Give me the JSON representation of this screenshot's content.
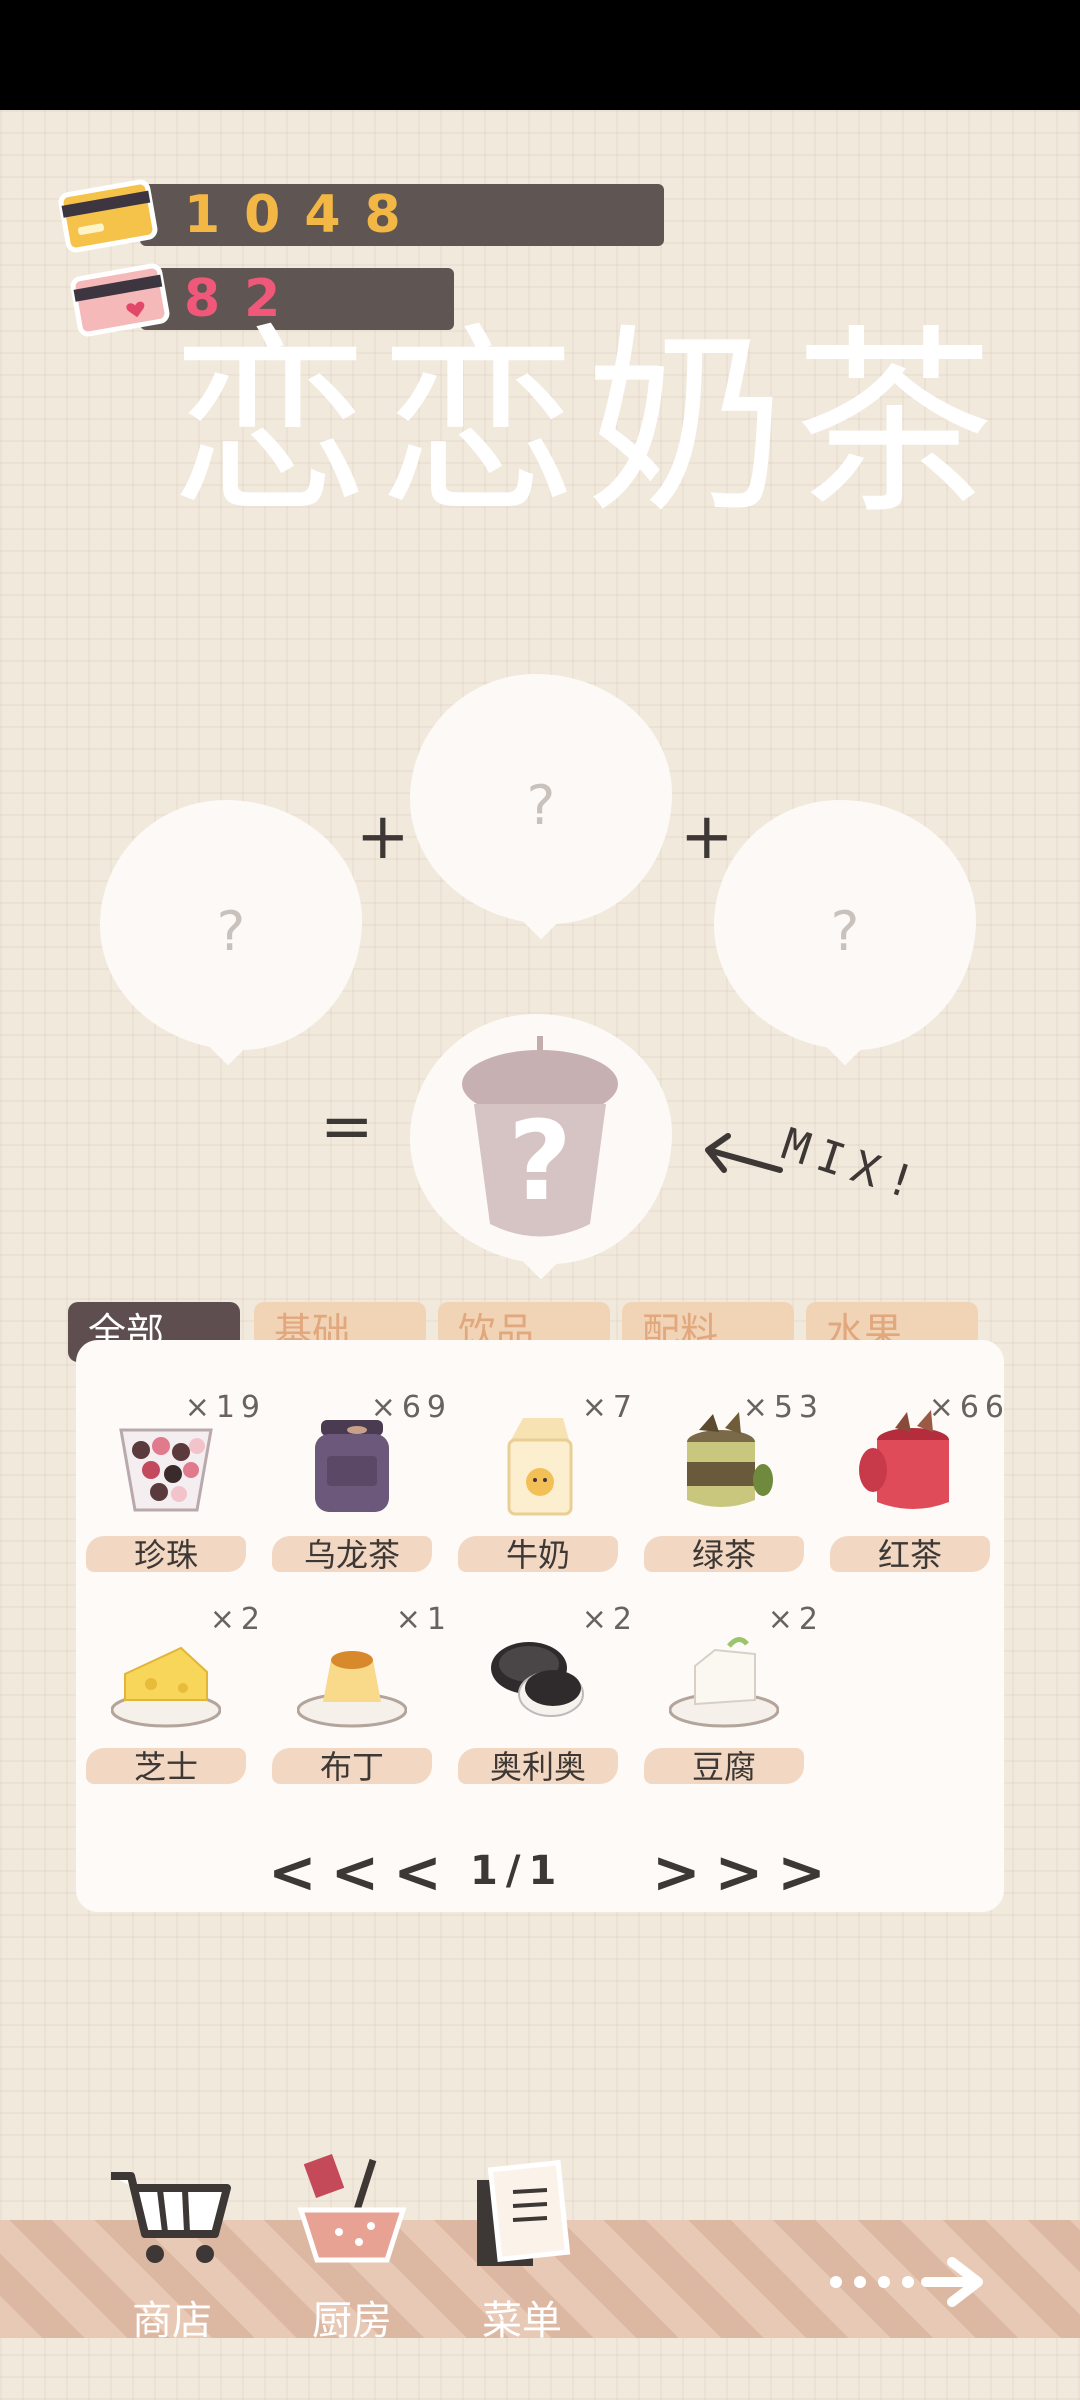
{
  "currency": {
    "coins": "1048",
    "hearts": "82"
  },
  "title": "恋恋奶茶",
  "mix": {
    "slot_placeholder": "?",
    "plus": "+",
    "equals": "=",
    "hint": "MIX!"
  },
  "tabs": [
    {
      "label": "全部",
      "active": true
    },
    {
      "label": "基础",
      "active": false
    },
    {
      "label": "饮品",
      "active": false
    },
    {
      "label": "配料",
      "active": false
    },
    {
      "label": "水果",
      "active": false
    }
  ],
  "items": [
    {
      "name": "珍珠",
      "qty": "×19"
    },
    {
      "name": "乌龙茶",
      "qty": "×69"
    },
    {
      "name": "牛奶",
      "qty": "×7"
    },
    {
      "name": "绿茶",
      "qty": "×53"
    },
    {
      "name": "红茶",
      "qty": "×66"
    },
    {
      "name": "芝士",
      "qty": "×2"
    },
    {
      "name": "布丁",
      "qty": "×1"
    },
    {
      "name": "奥利奥",
      "qty": "×2"
    },
    {
      "name": "豆腐",
      "qty": "×2"
    }
  ],
  "pager": {
    "prev": "<<<",
    "next": ">>>",
    "page": "1/1"
  },
  "nav": [
    {
      "label": "商店"
    },
    {
      "label": "厨房"
    },
    {
      "label": "菜单"
    }
  ],
  "colors": {
    "background": "#f2e9dd",
    "bar": "#5f5552",
    "coin_text": "#f2b745",
    "heart_text": "#f0587a",
    "tab_active": "#5f4e4f",
    "tab_inactive": "#f1d3b6"
  }
}
